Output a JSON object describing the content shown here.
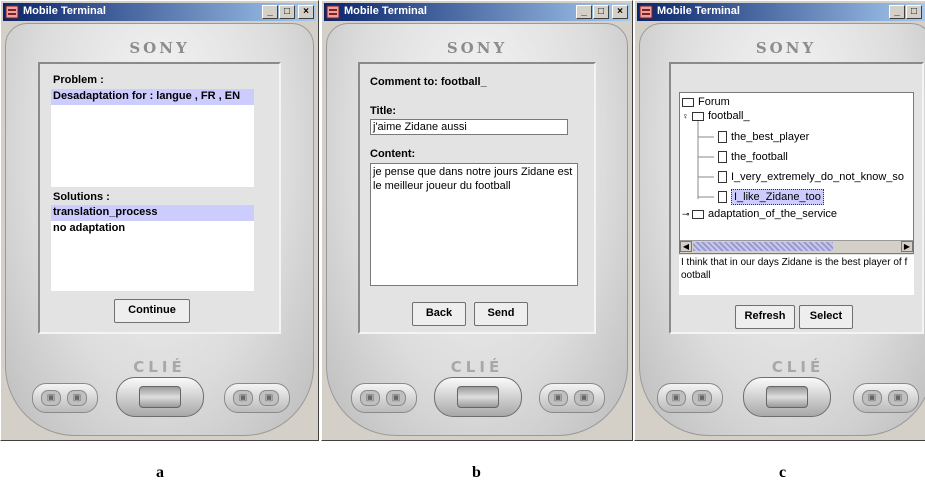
{
  "window_title": "Mobile Terminal",
  "brand": "SONY",
  "clie_logo": "CLIÉ",
  "title_buttons": {
    "minimize": "_",
    "maximize": "□",
    "close": "×"
  },
  "panel_a": {
    "problem_label": "Problem :",
    "problem_item": "Desadaptation for : langue , FR , EN",
    "solutions_label": "Solutions :",
    "solutions": [
      "translation_process",
      "no adaptation"
    ],
    "continue_button": "Continue",
    "caption": "a"
  },
  "panel_b": {
    "comment_label": "Comment to: football_",
    "title_label": "Title:",
    "title_value": "j'aime Zidane aussi",
    "content_label": "Content:",
    "content_value": "je pense que dans notre jours  Zidane est le meilleur joueur du football",
    "back_button": "Back",
    "send_button": "Send",
    "caption": "b"
  },
  "panel_c": {
    "tree": {
      "root": "Forum",
      "folder1": "football_",
      "children": [
        "the_best_player",
        "the_football",
        "I_very_extremely_do_not_know_so",
        "I_like_Zidane_too"
      ],
      "selected_index": 3,
      "folder2": "adaptation_of_the_service"
    },
    "message_text": "I think that in our days Zidane is the best player of football",
    "refresh_button": "Refresh",
    "select_button": "Select",
    "caption": "c"
  }
}
